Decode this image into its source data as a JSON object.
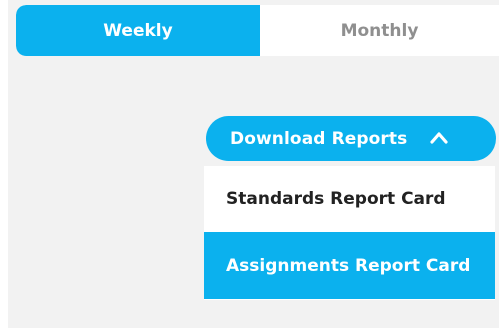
{
  "tabs": {
    "weekly_label": "Weekly",
    "monthly_label": "Monthly",
    "selected": "Weekly"
  },
  "download": {
    "button_label": "Download Reports",
    "icon": "chevron-up-icon",
    "expanded": true,
    "items": [
      {
        "label": "Standards Report Card",
        "highlighted": false
      },
      {
        "label": "Assignments Report Card",
        "highlighted": true
      }
    ]
  },
  "colors": {
    "accent": "#0bb1ee",
    "background": "#f2f2f2",
    "inactive_text": "#8f8f8f",
    "menu_text": "#222222"
  }
}
